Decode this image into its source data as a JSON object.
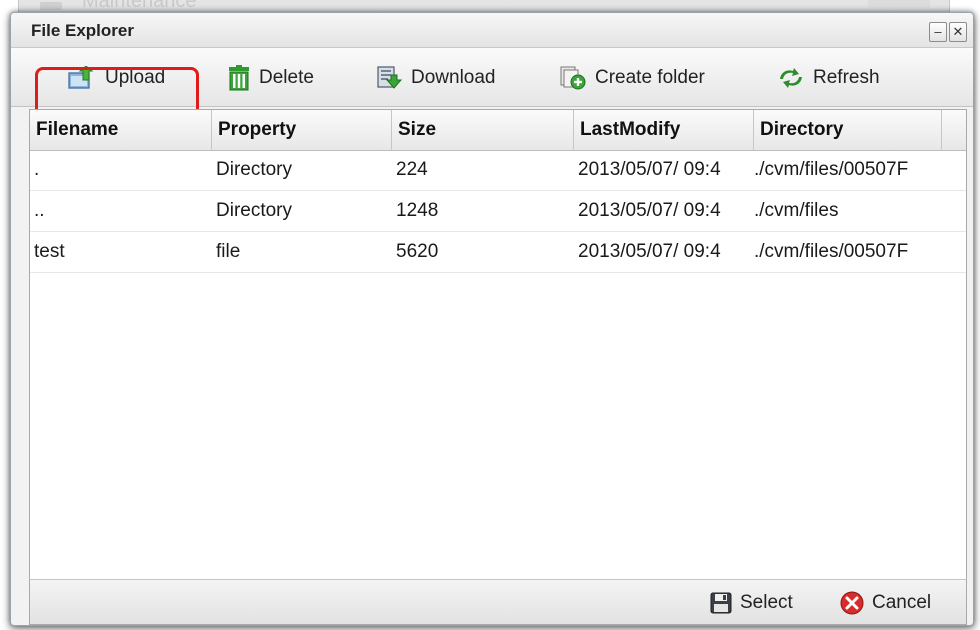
{
  "background_window": {
    "title": "Maintenance"
  },
  "dialog": {
    "title": "File Explorer",
    "controls": {
      "minimize": "–",
      "close": "✕"
    }
  },
  "toolbar": {
    "upload_label": "Upload",
    "delete_label": "Delete",
    "download_label": "Download",
    "create_folder_label": "Create folder",
    "refresh_label": "Refresh"
  },
  "table": {
    "columns": [
      "Filename",
      "Property",
      "Size",
      "LastModify",
      "Directory"
    ],
    "rows": [
      {
        "filename": ".",
        "property": "Directory",
        "size": "224",
        "last_modify": "2013/05/07/ 09:4",
        "directory": "./cvm/files/00507F"
      },
      {
        "filename": "..",
        "property": "Directory",
        "size": "1248",
        "last_modify": "2013/05/07/ 09:4",
        "directory": "./cvm/files"
      },
      {
        "filename": "test",
        "property": "file",
        "size": "5620",
        "last_modify": "2013/05/07/ 09:4",
        "directory": "./cvm/files/00507F"
      }
    ]
  },
  "footer": {
    "select_label": "Select",
    "cancel_label": "Cancel"
  },
  "colors": {
    "highlight": "#e01b1b",
    "delete_icon": "#3aa63a",
    "refresh_icon": "#2e8b2e",
    "cancel_icon": "#d92b2b"
  }
}
